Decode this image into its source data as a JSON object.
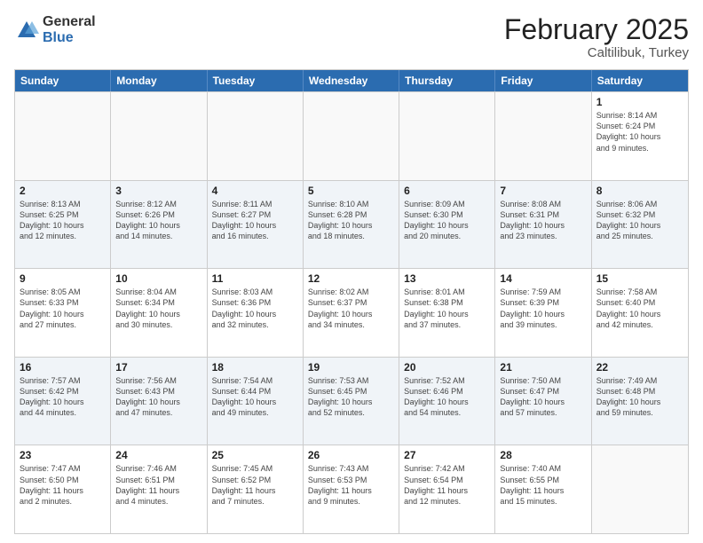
{
  "logo": {
    "general": "General",
    "blue": "Blue"
  },
  "title": "February 2025",
  "subtitle": "Caltilibuk, Turkey",
  "days": [
    "Sunday",
    "Monday",
    "Tuesday",
    "Wednesday",
    "Thursday",
    "Friday",
    "Saturday"
  ],
  "weeks": [
    [
      {
        "day": "",
        "info": ""
      },
      {
        "day": "",
        "info": ""
      },
      {
        "day": "",
        "info": ""
      },
      {
        "day": "",
        "info": ""
      },
      {
        "day": "",
        "info": ""
      },
      {
        "day": "",
        "info": ""
      },
      {
        "day": "1",
        "info": "Sunrise: 8:14 AM\nSunset: 6:24 PM\nDaylight: 10 hours\nand 9 minutes."
      }
    ],
    [
      {
        "day": "2",
        "info": "Sunrise: 8:13 AM\nSunset: 6:25 PM\nDaylight: 10 hours\nand 12 minutes."
      },
      {
        "day": "3",
        "info": "Sunrise: 8:12 AM\nSunset: 6:26 PM\nDaylight: 10 hours\nand 14 minutes."
      },
      {
        "day": "4",
        "info": "Sunrise: 8:11 AM\nSunset: 6:27 PM\nDaylight: 10 hours\nand 16 minutes."
      },
      {
        "day": "5",
        "info": "Sunrise: 8:10 AM\nSunset: 6:28 PM\nDaylight: 10 hours\nand 18 minutes."
      },
      {
        "day": "6",
        "info": "Sunrise: 8:09 AM\nSunset: 6:30 PM\nDaylight: 10 hours\nand 20 minutes."
      },
      {
        "day": "7",
        "info": "Sunrise: 8:08 AM\nSunset: 6:31 PM\nDaylight: 10 hours\nand 23 minutes."
      },
      {
        "day": "8",
        "info": "Sunrise: 8:06 AM\nSunset: 6:32 PM\nDaylight: 10 hours\nand 25 minutes."
      }
    ],
    [
      {
        "day": "9",
        "info": "Sunrise: 8:05 AM\nSunset: 6:33 PM\nDaylight: 10 hours\nand 27 minutes."
      },
      {
        "day": "10",
        "info": "Sunrise: 8:04 AM\nSunset: 6:34 PM\nDaylight: 10 hours\nand 30 minutes."
      },
      {
        "day": "11",
        "info": "Sunrise: 8:03 AM\nSunset: 6:36 PM\nDaylight: 10 hours\nand 32 minutes."
      },
      {
        "day": "12",
        "info": "Sunrise: 8:02 AM\nSunset: 6:37 PM\nDaylight: 10 hours\nand 34 minutes."
      },
      {
        "day": "13",
        "info": "Sunrise: 8:01 AM\nSunset: 6:38 PM\nDaylight: 10 hours\nand 37 minutes."
      },
      {
        "day": "14",
        "info": "Sunrise: 7:59 AM\nSunset: 6:39 PM\nDaylight: 10 hours\nand 39 minutes."
      },
      {
        "day": "15",
        "info": "Sunrise: 7:58 AM\nSunset: 6:40 PM\nDaylight: 10 hours\nand 42 minutes."
      }
    ],
    [
      {
        "day": "16",
        "info": "Sunrise: 7:57 AM\nSunset: 6:42 PM\nDaylight: 10 hours\nand 44 minutes."
      },
      {
        "day": "17",
        "info": "Sunrise: 7:56 AM\nSunset: 6:43 PM\nDaylight: 10 hours\nand 47 minutes."
      },
      {
        "day": "18",
        "info": "Sunrise: 7:54 AM\nSunset: 6:44 PM\nDaylight: 10 hours\nand 49 minutes."
      },
      {
        "day": "19",
        "info": "Sunrise: 7:53 AM\nSunset: 6:45 PM\nDaylight: 10 hours\nand 52 minutes."
      },
      {
        "day": "20",
        "info": "Sunrise: 7:52 AM\nSunset: 6:46 PM\nDaylight: 10 hours\nand 54 minutes."
      },
      {
        "day": "21",
        "info": "Sunrise: 7:50 AM\nSunset: 6:47 PM\nDaylight: 10 hours\nand 57 minutes."
      },
      {
        "day": "22",
        "info": "Sunrise: 7:49 AM\nSunset: 6:48 PM\nDaylight: 10 hours\nand 59 minutes."
      }
    ],
    [
      {
        "day": "23",
        "info": "Sunrise: 7:47 AM\nSunset: 6:50 PM\nDaylight: 11 hours\nand 2 minutes."
      },
      {
        "day": "24",
        "info": "Sunrise: 7:46 AM\nSunset: 6:51 PM\nDaylight: 11 hours\nand 4 minutes."
      },
      {
        "day": "25",
        "info": "Sunrise: 7:45 AM\nSunset: 6:52 PM\nDaylight: 11 hours\nand 7 minutes."
      },
      {
        "day": "26",
        "info": "Sunrise: 7:43 AM\nSunset: 6:53 PM\nDaylight: 11 hours\nand 9 minutes."
      },
      {
        "day": "27",
        "info": "Sunrise: 7:42 AM\nSunset: 6:54 PM\nDaylight: 11 hours\nand 12 minutes."
      },
      {
        "day": "28",
        "info": "Sunrise: 7:40 AM\nSunset: 6:55 PM\nDaylight: 11 hours\nand 15 minutes."
      },
      {
        "day": "",
        "info": ""
      }
    ]
  ]
}
